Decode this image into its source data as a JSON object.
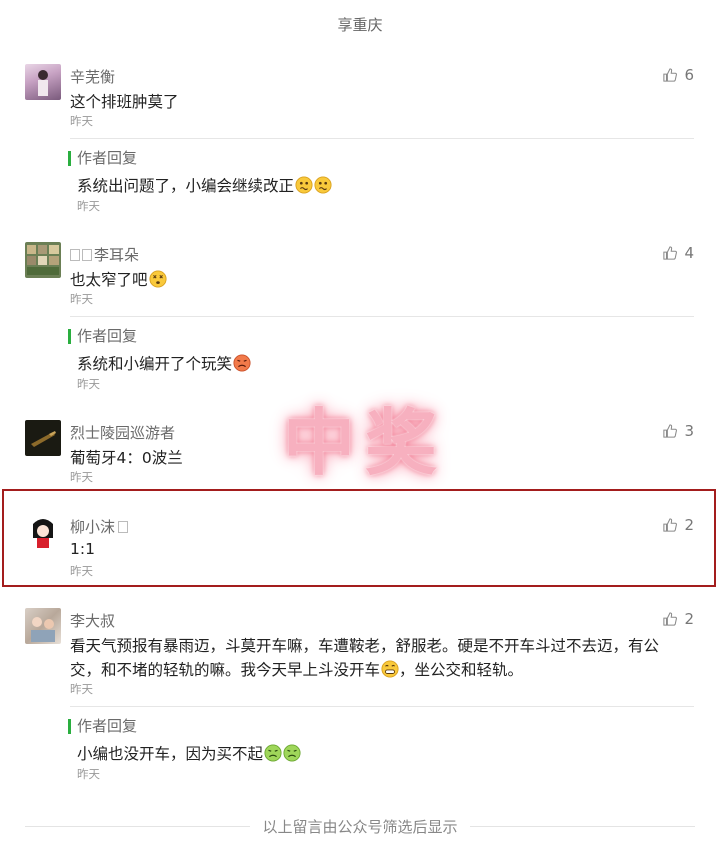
{
  "page_title": "享重庆",
  "comments": [
    {
      "name": "辛芜衡",
      "content": "这个排班肿莫了",
      "time": "昨天",
      "likes": "6",
      "reply": {
        "label": "作者回复",
        "content": "系统出问题了，小编会继续改正",
        "time": "昨天"
      }
    },
    {
      "name": "李耳朵",
      "content": "也太窄了吧",
      "time": "昨天",
      "likes": "4",
      "reply": {
        "label": "作者回复",
        "content": "系统和小编开了个玩笑",
        "time": "昨天"
      }
    },
    {
      "name": "烈士陵园巡游者",
      "content": "葡萄牙4：0波兰",
      "time": "昨天",
      "likes": "3"
    },
    {
      "name": "柳小沫",
      "content": "1:1",
      "time": "昨天",
      "likes": "2"
    },
    {
      "name": "李大叔",
      "content_line1": "看天气预报有暴雨迈，斗莫开车嘛，车遭鞍老，舒服老。硬是不开车斗过不去迈，有公",
      "content_line2a": "交，和不堵的轻轨的嘛。我今天早上斗没开车",
      "content_line2b": "，坐公交和轻轨。",
      "time": "昨天",
      "likes": "2",
      "reply": {
        "label": "作者回复",
        "content": "小编也没开车，因为买不起",
        "time": "昨天"
      }
    }
  ],
  "stamp_text": "中奖",
  "footer_text": "以上留言由公众号筛选后显示",
  "colors": {
    "highlight_border": "#a31d1d",
    "reply_bar": "#2aae3f",
    "stamp": "#f7b0bf"
  }
}
